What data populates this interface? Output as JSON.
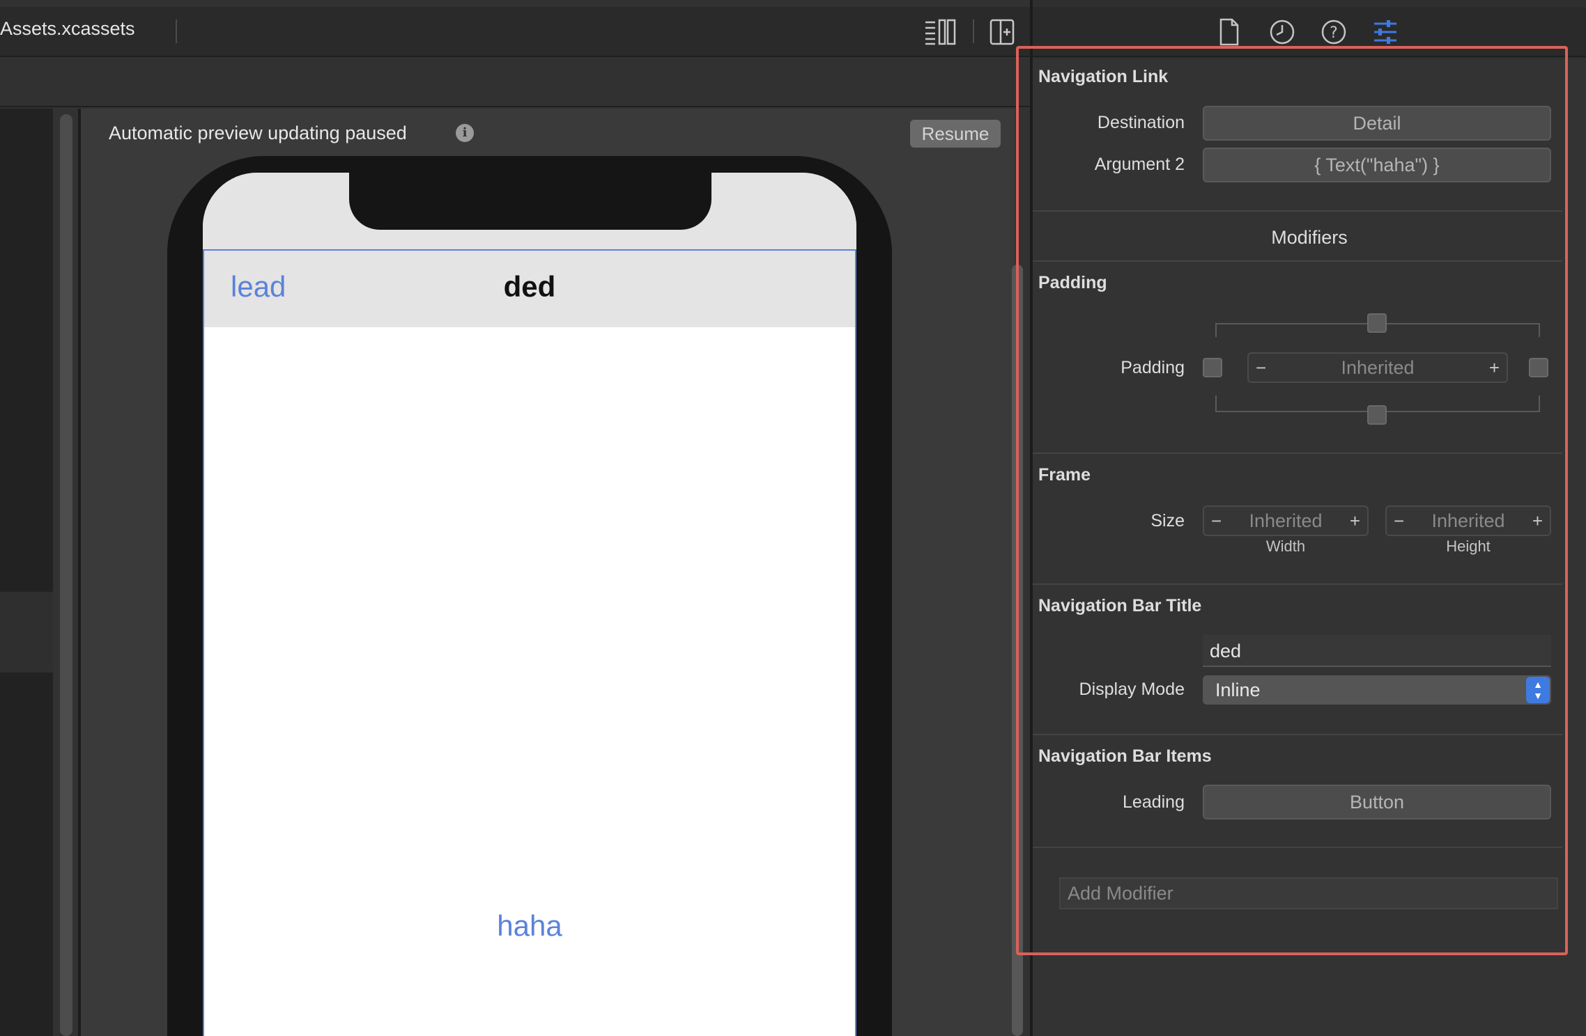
{
  "editor": {
    "tab_title": "Assets.xcassets",
    "preview_status": "Automatic preview updating paused",
    "resume_label": "Resume"
  },
  "preview": {
    "nav_leading": "lead",
    "nav_title": "ded",
    "link_text": "haha"
  },
  "inspector": {
    "toolbar_icons": [
      "file-icon",
      "history-icon",
      "help-icon",
      "attributes-icon"
    ],
    "navigation_link": {
      "title": "Navigation Link",
      "destination_label": "Destination",
      "destination_value": "Detail",
      "argument2_label": "Argument 2",
      "argument2_value": "{ Text(\"haha\") }"
    },
    "modifiers_title": "Modifiers",
    "padding": {
      "title": "Padding",
      "label": "Padding",
      "value": "Inherited",
      "minus": "−",
      "plus": "+"
    },
    "frame": {
      "title": "Frame",
      "size_label": "Size",
      "width_value": "Inherited",
      "height_value": "Inherited",
      "width_caption": "Width",
      "height_caption": "Height",
      "minus": "−",
      "plus": "+"
    },
    "nav_bar_title": {
      "title": "Navigation Bar Title",
      "value": "ded",
      "display_mode_label": "Display Mode",
      "display_mode_value": "Inline"
    },
    "nav_bar_items": {
      "title": "Navigation Bar Items",
      "leading_label": "Leading",
      "leading_value": "Button"
    },
    "add_modifier_placeholder": "Add Modifier"
  },
  "colors": {
    "accent": "#3f7ae0",
    "link_blue": "#5b82d9",
    "highlight_frame": "#d9625a"
  }
}
